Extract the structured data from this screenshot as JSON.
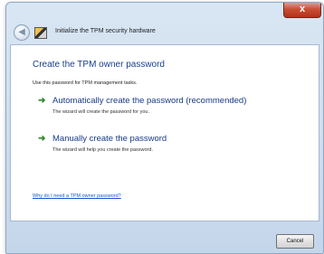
{
  "window": {
    "title": "Initialize the TPM security hardware",
    "close_label": "x"
  },
  "content": {
    "heading": "Create the TPM owner password",
    "instructions": "Use this password for TPM management tasks.",
    "options": [
      {
        "icon": "green-arrow-icon",
        "title": "Automatically create the password (recommended)",
        "description": "The wizard will create the password for you."
      },
      {
        "icon": "green-arrow-icon",
        "title": "Manually create the password",
        "description": "The wizard will help you create the password."
      }
    ],
    "help_link": "Why do I need a TPM owner password?"
  },
  "footer": {
    "cancel_label": "Cancel"
  }
}
